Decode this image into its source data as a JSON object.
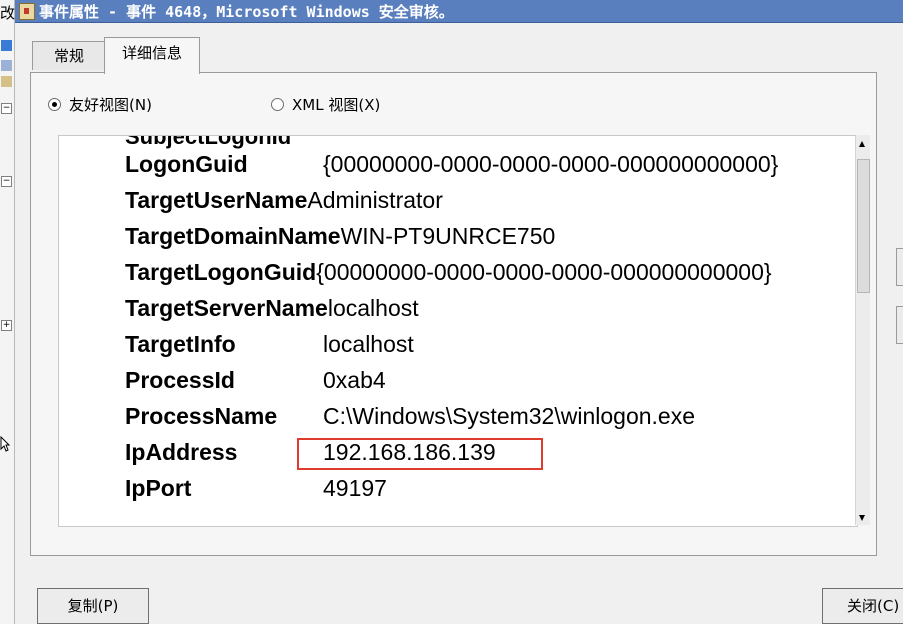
{
  "window": {
    "title": "事件属性 - 事件 4648，Microsoft Windows 安全审核。"
  },
  "left_strip": {
    "top_char": "改",
    "tree_expanders": [
      "−",
      "−",
      "+"
    ]
  },
  "tabs": [
    {
      "label": "常规",
      "active": false
    },
    {
      "label": "详细信息",
      "active": true
    }
  ],
  "view_options": {
    "friendly": {
      "label": "友好视图(N)",
      "checked": true
    },
    "xml": {
      "label": "XML 视图(X)",
      "checked": false
    }
  },
  "details": {
    "partial_row": "SubjectLogonId",
    "rows": [
      {
        "key": "LogonGuid",
        "value": "{00000000-0000-0000-0000-000000000000}"
      },
      {
        "key": "TargetUserName",
        "value": "Administrator"
      },
      {
        "key": "TargetDomainName",
        "value": "WIN-PT9UNRCE750"
      },
      {
        "key": "TargetLogonGuid",
        "value": "{00000000-0000-0000-0000-000000000000}"
      },
      {
        "key": "TargetServerName",
        "value": "localhost"
      },
      {
        "key": "TargetInfo",
        "value": "localhost"
      },
      {
        "key": "ProcessId",
        "value": "0xab4"
      },
      {
        "key": "ProcessName",
        "value": "C:\\Windows\\System32\\winlogon.exe"
      },
      {
        "key": "IpAddress",
        "value": "192.168.186.139"
      },
      {
        "key": "IpPort",
        "value": "49197"
      }
    ],
    "highlighted_key": "IpAddress"
  },
  "buttons": {
    "copy": "复制(P)",
    "close": "关闭(C)"
  },
  "colors": {
    "highlight": "#e03a2c",
    "titlebar": "#5a7fbe"
  }
}
